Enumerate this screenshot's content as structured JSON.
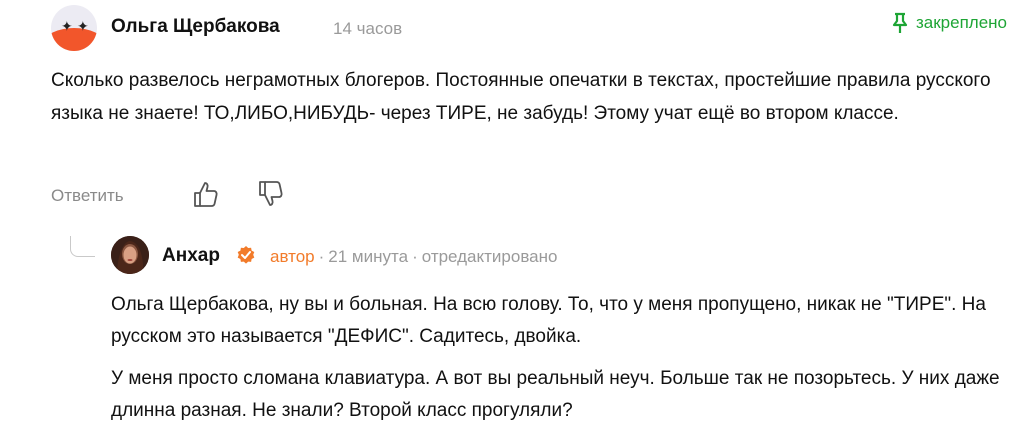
{
  "comment": {
    "author": "Ольга Щербакова",
    "time": "14 часов",
    "pinned_label": "закреплено",
    "text": "Сколько развелось неграмотных блогеров. Постоянные опечатки в текстах, простейшие правила русского языка не знаете! ТО,ЛИБО,НИБУДЬ- через ТИРЕ, не забудь! Этому учат ещё во втором классе.",
    "reply_label": "Ответить"
  },
  "reply": {
    "author": "Анхар",
    "role": "автор",
    "time": "21 минута",
    "edited": "отредактировано",
    "paragraphs": [
      "Ольга Щербакова, ну вы и больная. На всю голову. То, что у меня пропущено, никак не \"ТИРЕ\". На русском это называется \"ДЕФИС\". Садитесь, двойка.",
      "У меня просто сломана клавиатура. А вот вы реальный неуч. Больше так не позорьтесь. У них даже длинна разная. Не знали? Второй класс прогуляли?"
    ]
  },
  "colors": {
    "pinned": "#1ea535",
    "author_role": "#f27b2a",
    "avatar_accent": "#f2562b",
    "meta": "#9a9a9a"
  },
  "icons": {
    "pin": "pin-icon",
    "like": "thumbs-up-icon",
    "dislike": "thumbs-down-icon",
    "verified": "verified-badge-icon"
  }
}
